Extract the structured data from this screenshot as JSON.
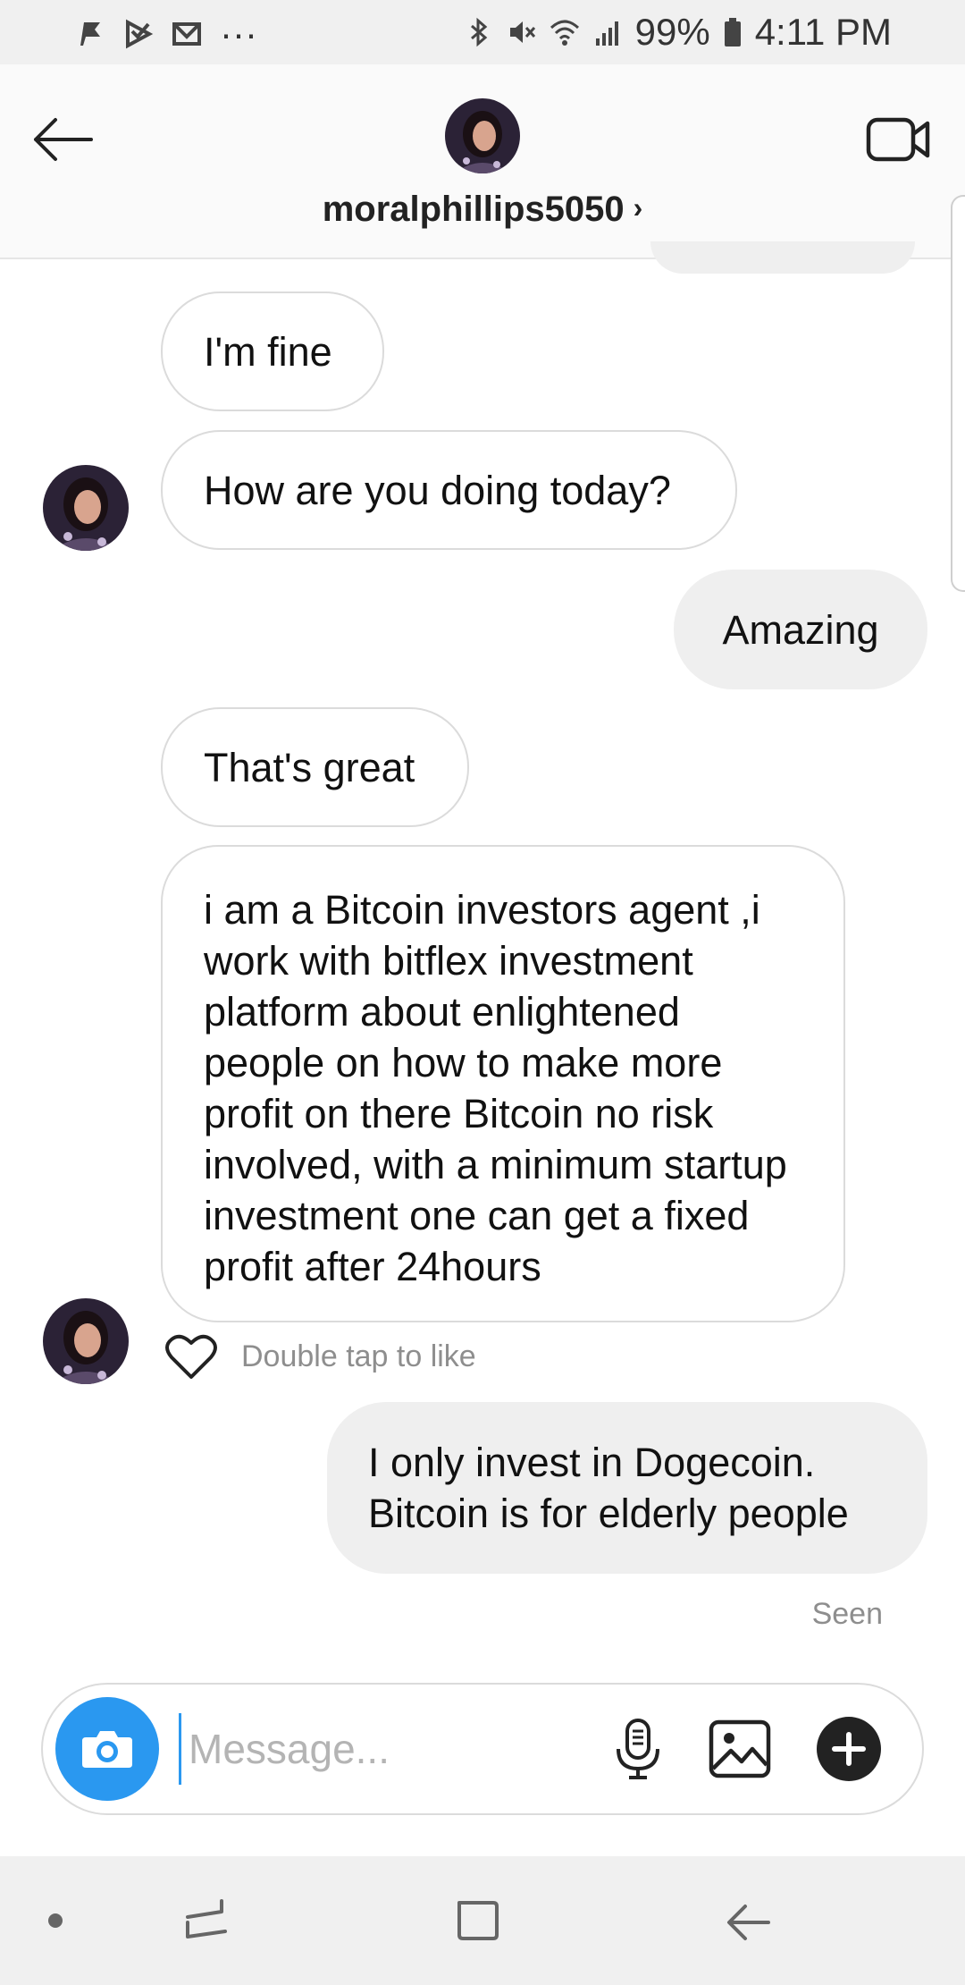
{
  "status_bar": {
    "battery": "99%",
    "time": "4:11 PM",
    "left_icons": [
      "flag-notification-icon",
      "play-notification-icon",
      "mail-notification-icon",
      "more-dots-icon"
    ],
    "right_icons": [
      "bluetooth-icon",
      "mute-icon",
      "wifi-icon",
      "signal-icon",
      "battery-icon"
    ]
  },
  "header": {
    "username": "moralphillips5050",
    "chevron": "›"
  },
  "messages": [
    {
      "side": "in",
      "text": "I'm fine"
    },
    {
      "side": "in",
      "text": "How are you doing today?"
    },
    {
      "side": "out",
      "text": "Amazing"
    },
    {
      "side": "in",
      "text": "That's great"
    },
    {
      "side": "in",
      "text": "i am a Bitcoin investors agent ,i work with bitflex investment platform about enlightened people on how to make more profit on there Bitcoin no risk involved, with a minimum startup investment one can get a fixed profit after 24hours"
    },
    {
      "side": "out",
      "text": "I only invest in Dogecoin. Bitcoin is for elderly people"
    }
  ],
  "like_hint": "Double tap to like",
  "seen_label": "Seen",
  "composer": {
    "placeholder": "Message..."
  },
  "colors": {
    "accent_blue": "#2a98f0",
    "outgoing_bubble": "#efefef",
    "incoming_border": "#dbdbdb",
    "muted_text": "#8e8e8e"
  }
}
